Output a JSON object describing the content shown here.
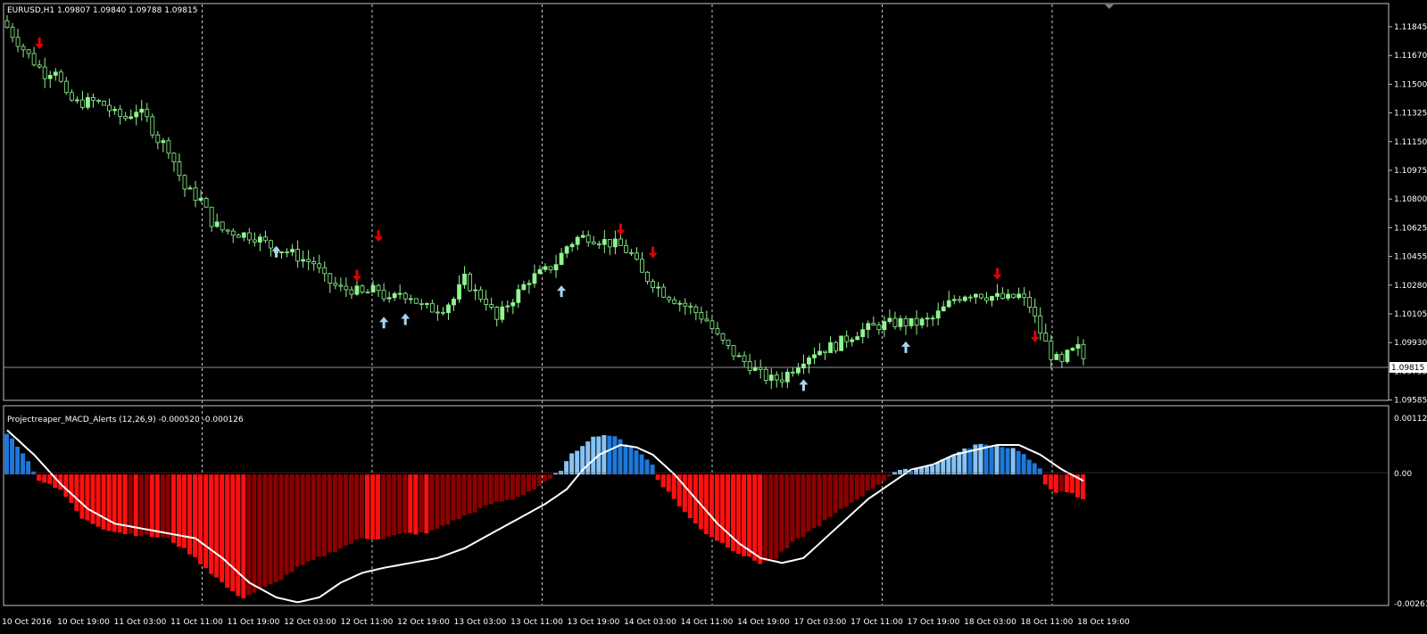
{
  "window": {
    "symbol_header": "EURUSD,H1  1.09807 1.09840 1.09788 1.09815",
    "indicator_header": "Projectreaper_MACD_Alerts (12,26,9)  -0.000520 -0.000126"
  },
  "colors": {
    "background": "#000000",
    "frame": "#c0c0c0",
    "grid": "#c8c8c8",
    "candle_bull": "#8ff58f",
    "candle_bear": "#000000",
    "candle_wick": "#8ff58f",
    "arrow_down": "#e00000",
    "arrow_up": "#a8d4f0",
    "hist_pos_light": "#87c3f5",
    "hist_pos_dark": "#1e78dc",
    "hist_neg_light": "#ff1010",
    "hist_neg_dark": "#8c0000",
    "signal_line": "#ffffff",
    "current_price_line": "#c0c0c0"
  },
  "chart_data": [
    {
      "type": "candlestick",
      "title": "EURUSD,H1",
      "ohlc_header": [
        "1.09807",
        "1.09840",
        "1.09788",
        "1.09815"
      ],
      "ylim": [
        1.0957,
        1.1192
      ],
      "price_ticks": [
        "1.11845",
        "1.11670",
        "1.11500",
        "1.11325",
        "1.11150",
        "1.10975",
        "1.10800",
        "1.10625",
        "1.10455",
        "1.10280",
        "1.10105",
        "1.09930",
        "1.09755",
        "1.09585"
      ],
      "current_price": "1.09815",
      "x_labels": [
        "10 Oct 2016",
        "10 Oct 19:00",
        "11 Oct 03:00",
        "11 Oct 11:00",
        "11 Oct 19:00",
        "12 Oct 03:00",
        "12 Oct 11:00",
        "12 Oct 19:00",
        "13 Oct 03:00",
        "13 Oct 11:00",
        "13 Oct 19:00",
        "14 Oct 03:00",
        "14 Oct 11:00",
        "14 Oct 19:00",
        "17 Oct 03:00",
        "17 Oct 11:00",
        "17 Oct 19:00",
        "18 Oct 03:00",
        "18 Oct 11:00",
        "18 Oct 19:00"
      ],
      "close_anchors": [
        [
          0,
          1.1183
        ],
        [
          3,
          1.117
        ],
        [
          5,
          1.1162
        ],
        [
          7,
          1.1155
        ],
        [
          9,
          1.1158
        ],
        [
          11,
          1.114
        ],
        [
          13,
          1.1137
        ],
        [
          16,
          1.1138
        ],
        [
          18,
          1.1136
        ],
        [
          20,
          1.113
        ],
        [
          22,
          1.1128
        ],
        [
          24,
          1.1133
        ],
        [
          26,
          1.1127
        ],
        [
          28,
          1.1115
        ],
        [
          30,
          1.111
        ],
        [
          33,
          1.1085
        ],
        [
          36,
          1.1078
        ],
        [
          38,
          1.1065
        ],
        [
          40,
          1.106
        ],
        [
          43,
          1.1058
        ],
        [
          46,
          1.1056
        ],
        [
          49,
          1.105
        ],
        [
          52,
          1.1047
        ],
        [
          55,
          1.1042
        ],
        [
          57,
          1.104
        ],
        [
          59,
          1.103
        ],
        [
          62,
          1.1024
        ],
        [
          64,
          1.1024
        ],
        [
          66,
          1.1021
        ],
        [
          69,
          1.1024
        ],
        [
          71,
          1.1016
        ],
        [
          73,
          1.1022
        ],
        [
          75,
          1.102
        ],
        [
          77,
          1.1013
        ],
        [
          79,
          1.1012
        ],
        [
          81,
          1.1013
        ],
        [
          83,
          1.1018
        ],
        [
          85,
          1.103
        ],
        [
          87,
          1.1022
        ],
        [
          89,
          1.1017
        ],
        [
          91,
          1.1005
        ],
        [
          93,
          1.1015
        ],
        [
          95,
          1.1022
        ],
        [
          97,
          1.103
        ],
        [
          100,
          1.1035
        ],
        [
          102,
          1.104
        ],
        [
          104,
          1.105
        ],
        [
          106,
          1.1055
        ],
        [
          108,
          1.1056
        ],
        [
          110,
          1.1054
        ],
        [
          112,
          1.1052
        ],
        [
          114,
          1.105
        ],
        [
          116,
          1.1045
        ],
        [
          118,
          1.1033
        ],
        [
          120,
          1.1028
        ],
        [
          122,
          1.1022
        ],
        [
          124,
          1.1018
        ],
        [
          126,
          1.1014
        ],
        [
          128,
          1.101
        ],
        [
          130,
          1.1005
        ],
        [
          132,
          1.0995
        ],
        [
          134,
          1.0988
        ],
        [
          136,
          1.0982
        ],
        [
          138,
          1.0978
        ],
        [
          140,
          1.0972
        ],
        [
          142,
          1.0969
        ],
        [
          144,
          1.097
        ],
        [
          146,
          1.0976
        ],
        [
          148,
          1.0982
        ],
        [
          150,
          1.0986
        ],
        [
          152,
          1.0988
        ],
        [
          154,
          1.099
        ],
        [
          156,
          1.0994
        ],
        [
          158,
          1.0998
        ],
        [
          160,
          1.1
        ],
        [
          162,
          1.1002
        ],
        [
          164,
          1.1003
        ],
        [
          166,
          1.1004
        ],
        [
          168,
          1.1003
        ],
        [
          170,
          1.1004
        ],
        [
          172,
          1.1006
        ],
        [
          174,
          1.1012
        ],
        [
          176,
          1.1018
        ],
        [
          178,
          1.1021
        ],
        [
          180,
          1.1022
        ],
        [
          182,
          1.102
        ],
        [
          184,
          1.1019
        ],
        [
          186,
          1.1018
        ],
        [
          188,
          1.102
        ],
        [
          190,
          1.1014
        ],
        [
          192,
          1.0998
        ],
        [
          194,
          1.0984
        ],
        [
          196,
          1.0978
        ],
        [
          197,
          1.0984
        ],
        [
          199,
          1.0988
        ],
        [
          200,
          1.0982
        ]
      ],
      "down_arrows": [
        {
          "i": 6,
          "price": 1.1173
        },
        {
          "i": 65,
          "price": 1.1032
        },
        {
          "i": 69,
          "price": 1.1056
        },
        {
          "i": 114,
          "price": 1.106
        },
        {
          "i": 120,
          "price": 1.1046
        },
        {
          "i": 184,
          "price": 1.1033
        },
        {
          "i": 191,
          "price": 1.0995
        }
      ],
      "up_arrows": [
        {
          "i": 50,
          "price": 1.1047
        },
        {
          "i": 70,
          "price": 1.1004
        },
        {
          "i": 74,
          "price": 1.1006
        },
        {
          "i": 103,
          "price": 1.1023
        },
        {
          "i": 148,
          "price": 1.0966
        },
        {
          "i": 167,
          "price": 1.0989
        }
      ]
    },
    {
      "type": "bar",
      "title": "Projectreaper_MACD_Alerts (12,26,9)",
      "ylim": [
        -0.00261,
        0.00127
      ],
      "y_ticks": [
        "0.001127",
        "0.00",
        "-0.00261"
      ],
      "histogram_anchors": [
        [
          0,
          0.00085
        ],
        [
          3,
          0.00045
        ],
        [
          5,
          5e-05
        ],
        [
          6,
          -0.0001
        ],
        [
          10,
          -0.0003
        ],
        [
          14,
          -0.0009
        ],
        [
          18,
          -0.0011
        ],
        [
          22,
          -0.0012
        ],
        [
          26,
          -0.00125
        ],
        [
          30,
          -0.0013
        ],
        [
          34,
          -0.0016
        ],
        [
          38,
          -0.002
        ],
        [
          42,
          -0.0024
        ],
        [
          44,
          -0.0025
        ],
        [
          46,
          -0.0024
        ],
        [
          50,
          -0.0022
        ],
        [
          54,
          -0.0019
        ],
        [
          58,
          -0.0017
        ],
        [
          62,
          -0.0015
        ],
        [
          66,
          -0.0013
        ],
        [
          70,
          -0.0013
        ],
        [
          74,
          -0.0012
        ],
        [
          78,
          -0.0012
        ],
        [
          82,
          -0.001
        ],
        [
          86,
          -0.0008
        ],
        [
          90,
          -0.0006
        ],
        [
          94,
          -0.0005
        ],
        [
          98,
          -0.0003
        ],
        [
          101,
          -0.0001
        ],
        [
          103,
          0.0001
        ],
        [
          105,
          0.0004
        ],
        [
          108,
          0.0007
        ],
        [
          110,
          0.0008
        ],
        [
          112,
          0.0008
        ],
        [
          114,
          0.0007
        ],
        [
          117,
          0.0005
        ],
        [
          120,
          0.0002
        ],
        [
          121,
          -0.0001
        ],
        [
          124,
          -0.0005
        ],
        [
          127,
          -0.0009
        ],
        [
          130,
          -0.0012
        ],
        [
          133,
          -0.0014
        ],
        [
          136,
          -0.0016
        ],
        [
          140,
          -0.0018
        ],
        [
          143,
          -0.0017
        ],
        [
          146,
          -0.0014
        ],
        [
          150,
          -0.0011
        ],
        [
          154,
          -0.0008
        ],
        [
          158,
          -0.0005
        ],
        [
          162,
          -0.0002
        ],
        [
          165,
          5e-05
        ],
        [
          168,
          0.0001
        ],
        [
          172,
          0.0002
        ],
        [
          176,
          0.0004
        ],
        [
          180,
          0.0006
        ],
        [
          184,
          0.0006
        ],
        [
          188,
          0.0005
        ],
        [
          192,
          0.0001
        ],
        [
          193,
          -0.0002
        ],
        [
          195,
          -0.00035
        ],
        [
          198,
          -0.0004
        ],
        [
          200,
          -0.00052
        ]
      ],
      "signal_anchors": [
        [
          0,
          0.0009
        ],
        [
          5,
          0.0004
        ],
        [
          10,
          -0.0002
        ],
        [
          15,
          -0.0007
        ],
        [
          20,
          -0.001
        ],
        [
          25,
          -0.0011
        ],
        [
          30,
          -0.0012
        ],
        [
          35,
          -0.0013
        ],
        [
          40,
          -0.0017
        ],
        [
          45,
          -0.0022
        ],
        [
          50,
          -0.0025
        ],
        [
          54,
          -0.0026
        ],
        [
          58,
          -0.0025
        ],
        [
          62,
          -0.0022
        ],
        [
          66,
          -0.002
        ],
        [
          70,
          -0.0019
        ],
        [
          75,
          -0.0018
        ],
        [
          80,
          -0.0017
        ],
        [
          85,
          -0.0015
        ],
        [
          90,
          -0.0012
        ],
        [
          95,
          -0.0009
        ],
        [
          100,
          -0.0006
        ],
        [
          104,
          -0.0003
        ],
        [
          107,
          0.0001
        ],
        [
          110,
          0.0004
        ],
        [
          114,
          0.0006
        ],
        [
          117,
          0.00055
        ],
        [
          120,
          0.0004
        ],
        [
          124,
          0.0
        ],
        [
          128,
          -0.0005
        ],
        [
          132,
          -0.001
        ],
        [
          136,
          -0.0014
        ],
        [
          140,
          -0.0017
        ],
        [
          144,
          -0.0018
        ],
        [
          148,
          -0.0017
        ],
        [
          152,
          -0.0013
        ],
        [
          156,
          -0.0009
        ],
        [
          160,
          -0.0005
        ],
        [
          164,
          -0.0002
        ],
        [
          168,
          0.0001
        ],
        [
          172,
          0.0002
        ],
        [
          176,
          0.0004
        ],
        [
          180,
          0.0005
        ],
        [
          184,
          0.0006
        ],
        [
          188,
          0.0006
        ],
        [
          192,
          0.0004
        ],
        [
          196,
          0.0001
        ],
        [
          200,
          -0.00013
        ]
      ]
    }
  ]
}
